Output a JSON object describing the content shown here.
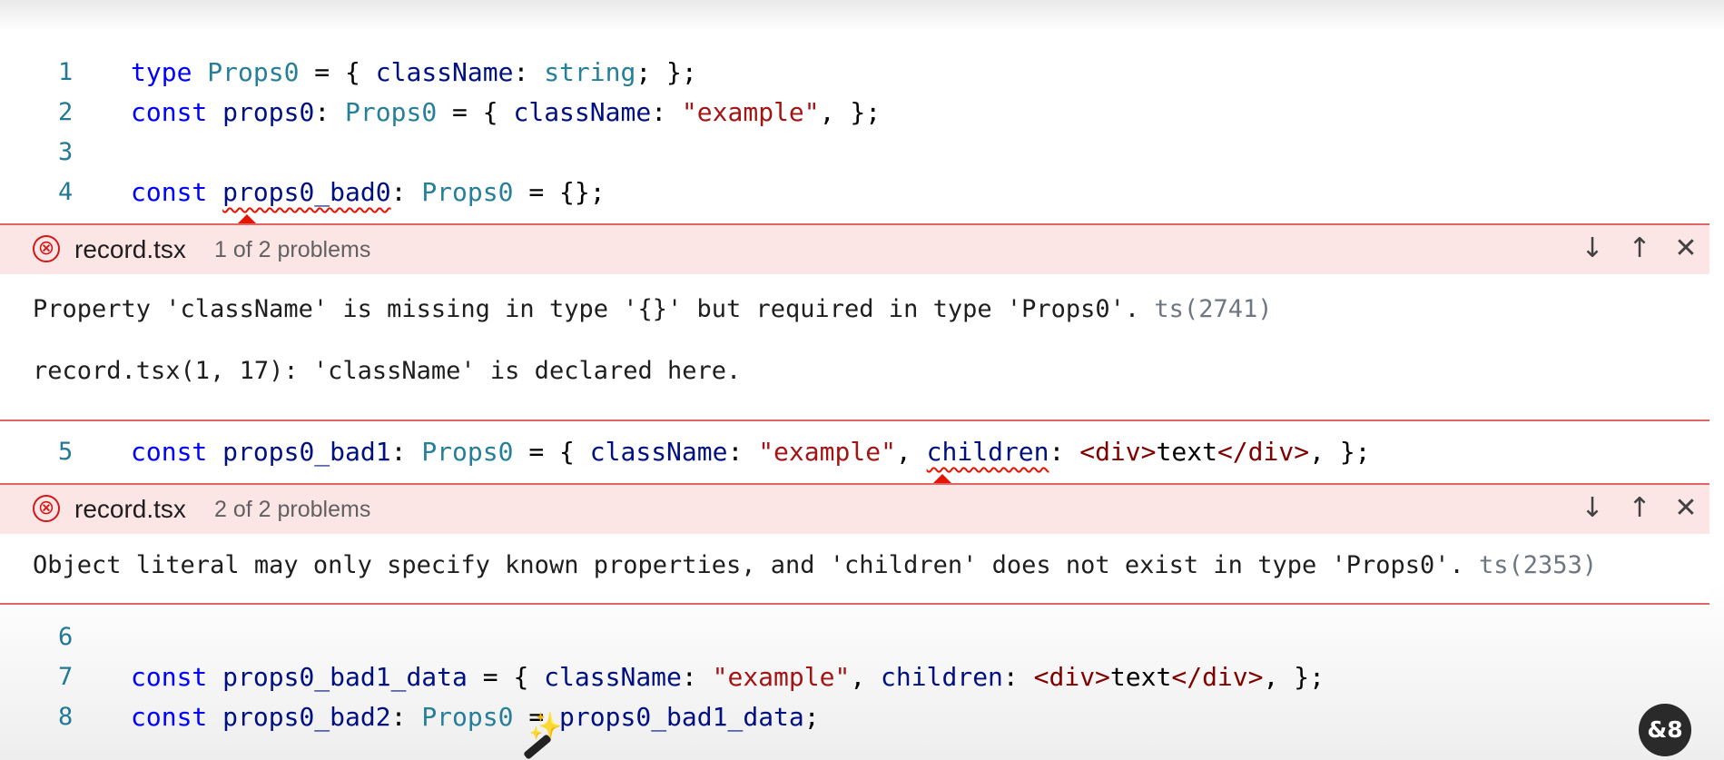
{
  "editor": {
    "lines_top": [
      {
        "num": "1"
      },
      {
        "num": "2"
      },
      {
        "num": "3"
      },
      {
        "num": "4"
      }
    ],
    "line1": {
      "t1": "type",
      "t2": "Props0",
      "t3": " = { ",
      "t4": "className",
      "t5": ": ",
      "t6": "string",
      "t7": "; };"
    },
    "line2": {
      "t1": "const",
      "t2": "props0",
      "t3": ": ",
      "t4": "Props0",
      "t5": " = { ",
      "t6": "className",
      "t7": ": ",
      "t8": "\"example\"",
      "t9": ", };"
    },
    "line4": {
      "t1": "const",
      "t2": "props0_bad0",
      "t3": ": ",
      "t4": "Props0",
      "t5": " = {};"
    },
    "line5": {
      "num": "5",
      "t1": "const",
      "t2": "props0_bad1",
      "t3": ": ",
      "t4": "Props0",
      "t5": " = { ",
      "t6": "className",
      "t7": ": ",
      "t8": "\"example\"",
      "t9": ", ",
      "t10": "children",
      "t11": ": ",
      "t12": "<div>",
      "t13": "text",
      "t14": "</div>",
      "t15": ", };"
    },
    "line6": {
      "num": "6"
    },
    "line7": {
      "num": "7",
      "t1": "const",
      "t2": "props0_bad1_data",
      "t3": " = { ",
      "t4": "className",
      "t5": ": ",
      "t6": "\"example\"",
      "t7": ", ",
      "t8": "children",
      "t9": ": ",
      "t10": "<div>",
      "t11": "text",
      "t12": "</div>",
      "t13": ", };"
    },
    "line8": {
      "num": "8",
      "t1": "const",
      "t2": "props0_bad2",
      "t3": ": ",
      "t4": "Props0",
      "t5": " = ",
      "t6": "props0_bad1_data",
      "t7": ";"
    }
  },
  "peek1": {
    "file": "record.tsx",
    "count": "1 of 2 problems",
    "message": "Property 'className' is missing in type '{}' but required in type 'Props0'. ",
    "code": "ts(2741)",
    "related": "record.tsx(1, 17): 'className' is declared here."
  },
  "peek2": {
    "file": "record.tsx",
    "count": "2 of 2 problems",
    "message": "Object literal may only specify known properties, and 'children' does not exist in type 'Props0'. ",
    "code": "ts(2353)"
  },
  "icons": {
    "error": "⊗",
    "next": "↓",
    "prev": "↑",
    "close": "✕",
    "logo": "&8",
    "sparkle": "✨"
  },
  "colors": {
    "keyword": "#0000ff",
    "type": "#267f99",
    "variable": "#001080",
    "string": "#a31515",
    "error": "#e51400",
    "peek_header": "#fce5e5"
  }
}
